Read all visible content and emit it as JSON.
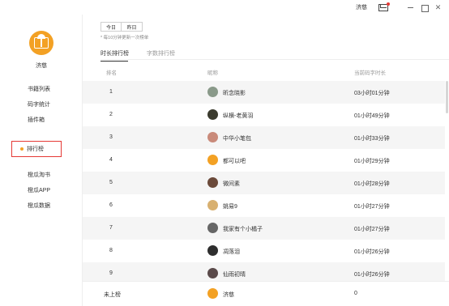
{
  "titlebar": {
    "username": "济慈",
    "icons": [
      "mail-icon",
      "minimize-icon",
      "maximize-icon",
      "close-icon"
    ],
    "close_glyph": "✕"
  },
  "sidebar": {
    "username": "济慈",
    "items": [
      {
        "label": "书籍列表"
      },
      {
        "label": "码字统计"
      },
      {
        "label": "插件箱"
      },
      {
        "label": "排行榜",
        "active": true
      },
      {
        "label": "橙瓜淘书"
      },
      {
        "label": "橙瓜APP"
      },
      {
        "label": "橙瓜数据"
      }
    ]
  },
  "main": {
    "date_buttons": [
      "今日",
      "昨日"
    ],
    "note": "* 每10分钟更新一次榜单",
    "tabs": [
      {
        "label": "时长排行榜",
        "active": true
      },
      {
        "label": "字数排行榜",
        "active": false
      }
    ],
    "headers": {
      "rank": "排名",
      "name": "昵称",
      "time": "当前码字时长"
    },
    "rows": [
      {
        "rank": "1",
        "name": "昕念晓影",
        "time": "03小时01分钟",
        "avatar_color": "#8a9a8a"
      },
      {
        "rank": "2",
        "name": "纵横-老黄羽",
        "time": "01小时49分钟",
        "avatar_color": "#3b3b2e"
      },
      {
        "rank": "3",
        "name": "中华小笔包",
        "time": "01小时33分钟",
        "avatar_color": "#c98a7a"
      },
      {
        "rank": "4",
        "name": "都可以吧",
        "time": "01小时29分钟",
        "avatar_color": "#f3a124"
      },
      {
        "rank": "5",
        "name": "微间素",
        "time": "01小时28分钟",
        "avatar_color": "#6b4a3a"
      },
      {
        "rank": "6",
        "name": "姚易9",
        "time": "01小时27分钟",
        "avatar_color": "#d8b070"
      },
      {
        "rank": "7",
        "name": "我家有个小橘子",
        "time": "01小时27分钟",
        "avatar_color": "#666666"
      },
      {
        "rank": "8",
        "name": "凋落泪",
        "time": "01小时26分钟",
        "avatar_color": "#2e2e2e"
      },
      {
        "rank": "9",
        "name": "仙雨初晴",
        "time": "01小时26分钟",
        "avatar_color": "#5a4a4a"
      }
    ],
    "footer": {
      "rank": "未上榜",
      "name": "济慈",
      "time": "0"
    }
  }
}
